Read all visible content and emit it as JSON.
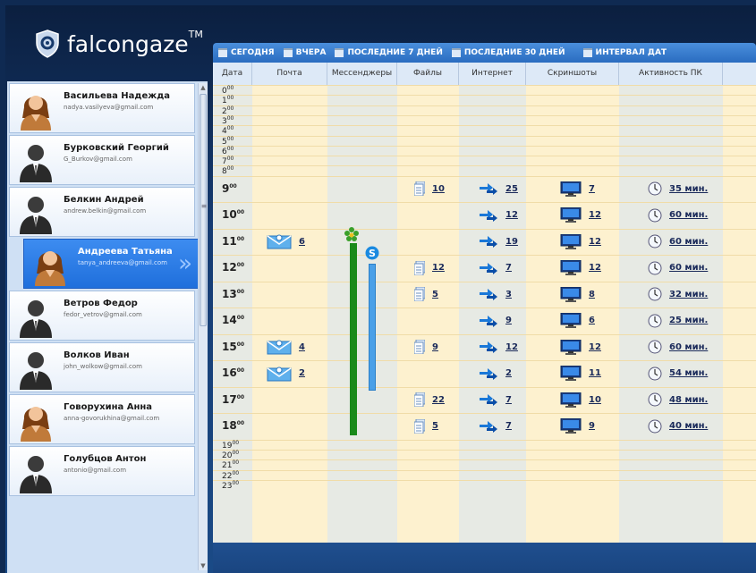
{
  "app": {
    "logo_text": "falcongaze",
    "logo_tm": "TM"
  },
  "toolbar": {
    "buttons": [
      "СЕГОДНЯ",
      "ВЧЕРА",
      "ПОСЛЕДНИЕ 7 ДНЕЙ",
      "ПОСЛЕДНИЕ 30 ДНЕЙ",
      "ИНТЕРВАЛ ДАТ"
    ]
  },
  "columns": [
    "Дата",
    "Почта",
    "Мессенджеры",
    "Файлы",
    "Интернет",
    "Скриншоты",
    "Активность ПК"
  ],
  "users": [
    {
      "name": "Васильева Надежда",
      "email": "nadya.vasilyeva@gmail.com",
      "gender": "female",
      "active": false
    },
    {
      "name": "Бурковский Георгий",
      "email": "G_Burkov@gmail.com",
      "gender": "male",
      "active": false
    },
    {
      "name": "Белкин Андрей",
      "email": "andrew.belkin@gmail.com",
      "gender": "male",
      "active": false
    },
    {
      "name": "Андреева Татьяна",
      "email": "tanya_andreeva@gmail.com",
      "gender": "female",
      "active": true
    },
    {
      "name": "Ветров Федор",
      "email": "fedor_vetrov@gmail.com",
      "gender": "male",
      "active": false
    },
    {
      "name": "Волков Иван",
      "email": "john_wolkow@gmail.com",
      "gender": "male",
      "active": false
    },
    {
      "name": "Говорухина Анна",
      "email": "anna-govorukhina@gmail.com",
      "gender": "female",
      "active": false
    },
    {
      "name": "Голубцов Антон",
      "email": "antonio@gmail.com",
      "gender": "male",
      "active": false
    }
  ],
  "hours": [
    {
      "h": "0",
      "m": "00"
    },
    {
      "h": "1",
      "m": "00"
    },
    {
      "h": "2",
      "m": "00"
    },
    {
      "h": "3",
      "m": "00"
    },
    {
      "h": "4",
      "m": "00"
    },
    {
      "h": "5",
      "m": "00"
    },
    {
      "h": "6",
      "m": "00"
    },
    {
      "h": "7",
      "m": "00"
    },
    {
      "h": "8",
      "m": "00"
    },
    {
      "h": "9",
      "m": "00"
    },
    {
      "h": "10",
      "m": "00"
    },
    {
      "h": "11",
      "m": "00"
    },
    {
      "h": "12",
      "m": "00"
    },
    {
      "h": "13",
      "m": "00"
    },
    {
      "h": "14",
      "m": "00"
    },
    {
      "h": "15",
      "m": "00"
    },
    {
      "h": "16",
      "m": "00"
    },
    {
      "h": "17",
      "m": "00"
    },
    {
      "h": "18",
      "m": "00"
    },
    {
      "h": "19",
      "m": "00"
    },
    {
      "h": "20",
      "m": "00"
    },
    {
      "h": "21",
      "m": "00"
    },
    {
      "h": "22",
      "m": "00"
    },
    {
      "h": "23",
      "m": "00"
    }
  ],
  "activity": [
    {
      "hour": 9,
      "mail": "",
      "files": "10",
      "internet": "25",
      "screens": "7",
      "pc": "35 мин."
    },
    {
      "hour": 10,
      "mail": "",
      "files": "",
      "internet": "12",
      "screens": "12",
      "pc": "60 мин."
    },
    {
      "hour": 11,
      "mail": "6",
      "files": "",
      "internet": "19",
      "screens": "12",
      "pc": "60 мин."
    },
    {
      "hour": 12,
      "mail": "",
      "files": "12",
      "internet": "7",
      "screens": "12",
      "pc": "60 мин."
    },
    {
      "hour": 13,
      "mail": "",
      "files": "5",
      "internet": "3",
      "screens": "8",
      "pc": "32 мин."
    },
    {
      "hour": 14,
      "mail": "",
      "files": "",
      "internet": "9",
      "screens": "6",
      "pc": "25 мин."
    },
    {
      "hour": 15,
      "mail": "4",
      "files": "9",
      "internet": "12",
      "screens": "12",
      "pc": "60 мин."
    },
    {
      "hour": 16,
      "mail": "2",
      "files": "",
      "internet": "2",
      "screens": "11",
      "pc": "54 мин."
    },
    {
      "hour": 17,
      "mail": "",
      "files": "22",
      "internet": "7",
      "screens": "10",
      "pc": "48 мин."
    },
    {
      "hour": 18,
      "mail": "",
      "files": "5",
      "internet": "7",
      "screens": "9",
      "pc": "40 мин."
    }
  ],
  "messengers": {
    "icq_icon": "flower-icon",
    "skype_icon": "skype-icon",
    "skype_letter": "S"
  },
  "colors": {
    "accent": "#2a6cc0",
    "row_bg": "#fdf1cf",
    "green_bar": "#1a8a1a",
    "blue_bar": "#4aa0e8"
  }
}
